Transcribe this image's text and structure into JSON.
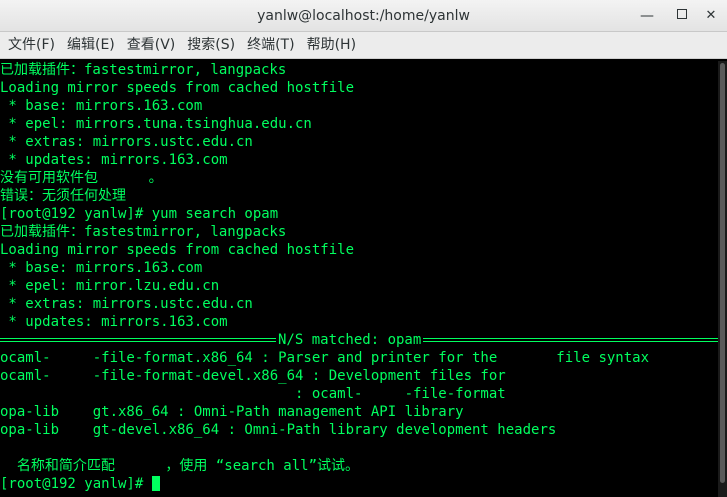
{
  "window": {
    "title": "yanlw@localhost:/home/yanlw"
  },
  "menu": [
    "文件(F)",
    "编辑(E)",
    "查看(V)",
    "搜索(S)",
    "终端(T)",
    "帮助(H)"
  ],
  "terminal": {
    "lines": [
      "已加载插件：fastestmirror, langpacks",
      "Loading mirror speeds from cached hostfile",
      " * base: mirrors.163.com",
      " * epel: mirrors.tuna.tsinghua.edu.cn",
      " * extras: mirrors.ustc.edu.cn",
      " * updates: mirrors.163.com",
      "没有可用软件包      。",
      "错误：无须任何处理",
      "[root@192 yanlw]# yum search opam",
      "已加载插件：fastestmirror, langpacks",
      "Loading mirror speeds from cached hostfile",
      " * base: mirrors.163.com",
      " * epel: mirror.lzu.edu.cn",
      " * extras: mirrors.ustc.edu.cn",
      " * updates: mirrors.163.com"
    ],
    "separator": "N/S matched: opam",
    "results": [
      "ocaml-     -file-format.x86_64 : Parser and printer for the       file syntax",
      "ocaml-     -file-format-devel.x86_64 : Development files for",
      "                                   : ocaml-     -file-format",
      "opa-lib    gt.x86_64 : Omni-Path management API library",
      "opa-lib    gt-devel.x86_64 : Omni-Path library development headers",
      "",
      "  名称和简介匹配      ，使用 “search all”试试。"
    ],
    "prompt": "[root@192 yanlw]# "
  },
  "colors": {
    "text": "#00ff5f",
    "background": "#000000"
  }
}
